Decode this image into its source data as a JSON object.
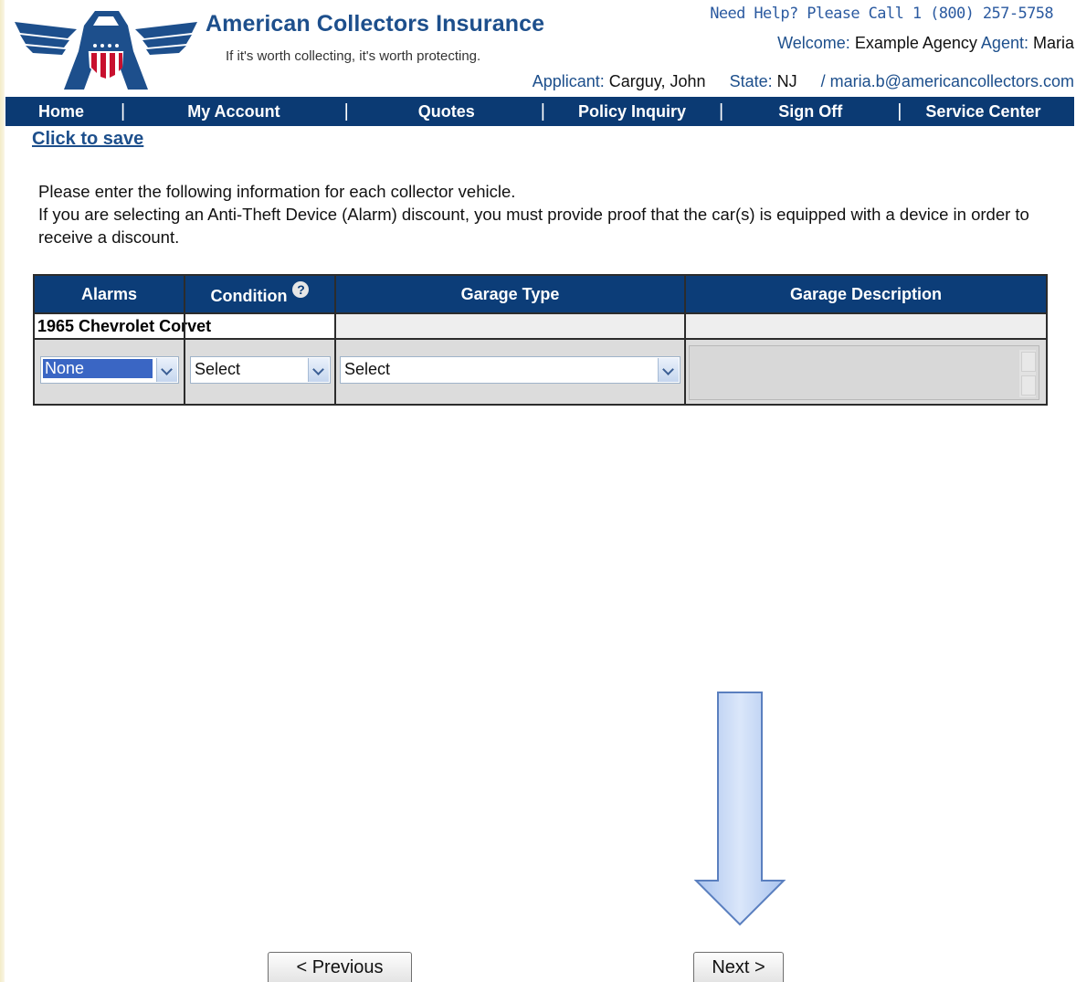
{
  "header": {
    "brand_title": "American Collectors Insurance",
    "brand_tagline": "If it's worth collecting, it's worth protecting.",
    "help_text": "Need Help? Please Call 1 (800) 257-5758",
    "welcome_label": "Welcome:",
    "agency": "Example Agency",
    "agent_label": "Agent:",
    "agent_name": "Maria",
    "applicant_label": "Applicant:",
    "applicant_name": "Carguy, John",
    "state_label": "State:",
    "state_value": "NJ",
    "email": "/ maria.b@americancollectors.com"
  },
  "nav": {
    "items": [
      "Home",
      "My Account",
      "Quotes",
      "Policy Inquiry",
      "Sign Off",
      "Service Center"
    ],
    "separator": "|"
  },
  "save_link": "Click to save",
  "instructions": {
    "line1": "Please enter the following information for each collector vehicle.",
    "line2": "If you are selecting an Anti-Theft Device (Alarm) discount, you must provide proof that the car(s) is equipped with a device in order to receive a discount."
  },
  "table": {
    "headers": {
      "alarms": "Alarms",
      "condition": "Condition",
      "condition_help": "?",
      "garage_type": "Garage Type",
      "garage_description": "Garage Description"
    },
    "vehicle": "1965 Chevrolet Corvet",
    "alarms_value": "None",
    "condition_value": "Select",
    "garage_type_value": "Select",
    "garage_description_value": ""
  },
  "buttons": {
    "previous": "< Previous",
    "next": "Next >"
  },
  "colors": {
    "nav_background": "#0b3a73",
    "header_blue": "#1d4f8c",
    "arrow_fill": "#b9cff2"
  },
  "icons": {
    "logo": "eagle-shield-logo",
    "help": "question-circle-icon",
    "dropdown": "chevron-down-icon",
    "arrow": "down-arrow-callout"
  }
}
